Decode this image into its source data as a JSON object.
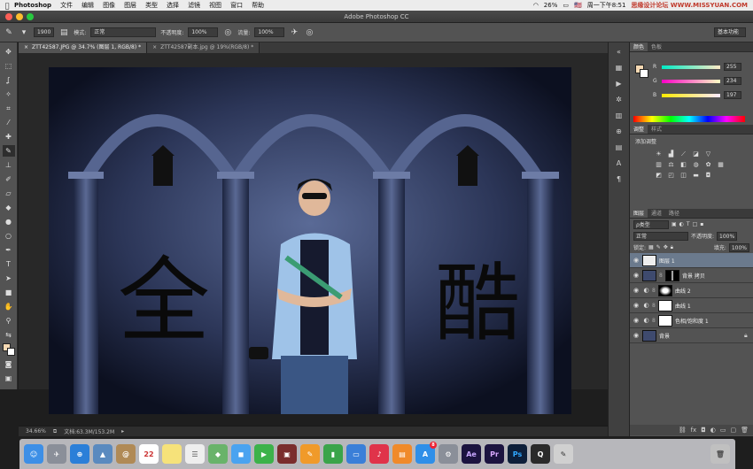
{
  "menubar": {
    "app": "Photoshop",
    "items": [
      "文件",
      "编辑",
      "图像",
      "图层",
      "类型",
      "选择",
      "滤镜",
      "视图",
      "窗口",
      "帮助"
    ],
    "battery": "26%",
    "flag_label": "🇺🇸",
    "clock": "周一下午8:51",
    "watermark": "思缘设计论坛 WWW.MISSYUAN.COM"
  },
  "titlebar": {
    "title": "Adobe Photoshop CC"
  },
  "options": {
    "brush_size": "1900",
    "mode_label": "模式:",
    "mode_value": "正常",
    "opacity_label": "不透明度:",
    "opacity_value": "100%",
    "flow_label": "流量:",
    "flow_value": "100%",
    "workspace": "基本功能"
  },
  "tabs": [
    {
      "label": "ZTT42587.JPG @ 34.7% (图层 1, RGB/8) *",
      "close": "×"
    },
    {
      "label": "ZTT42587副本.jpg @ 19%(RGB/8) *",
      "close": "×"
    }
  ],
  "status": {
    "zoom": "34.66%",
    "doc": "文档:63.3M/153.2M"
  },
  "canvas": {
    "char_left": "全",
    "char_right": "酷"
  },
  "color_panel": {
    "tabs": [
      "颜色",
      "色板"
    ],
    "r_label": "R",
    "r": "255",
    "g_label": "G",
    "g": "234",
    "b_label": "B",
    "b": "197"
  },
  "adjust_panel": {
    "tabs": [
      "调整",
      "样式"
    ],
    "title": "添加调整"
  },
  "layers_panel": {
    "tabs": [
      "图层",
      "通道",
      "路径"
    ],
    "kind": "ρ类型",
    "blend": "正常",
    "opacity_label": "不透明度:",
    "opacity": "100%",
    "lock_label": "锁定:",
    "fill_label": "填充:",
    "fill": "100%",
    "layers": [
      {
        "name": "图层 1"
      },
      {
        "name": "背景 拷贝"
      },
      {
        "name": "曲线 2"
      },
      {
        "name": "曲线 1"
      },
      {
        "name": "色相/饱和度 1"
      },
      {
        "name": "背景"
      }
    ]
  },
  "dock": {
    "calendar_day": "22",
    "appstore_badge": "8",
    "ae_label": "Ae",
    "pr_label": "Pr",
    "ps_label": "Ps"
  },
  "colors": {
    "foreground": "#f6d9b3",
    "background": "#ffffff",
    "selected_layer": "#6b7a8d"
  }
}
